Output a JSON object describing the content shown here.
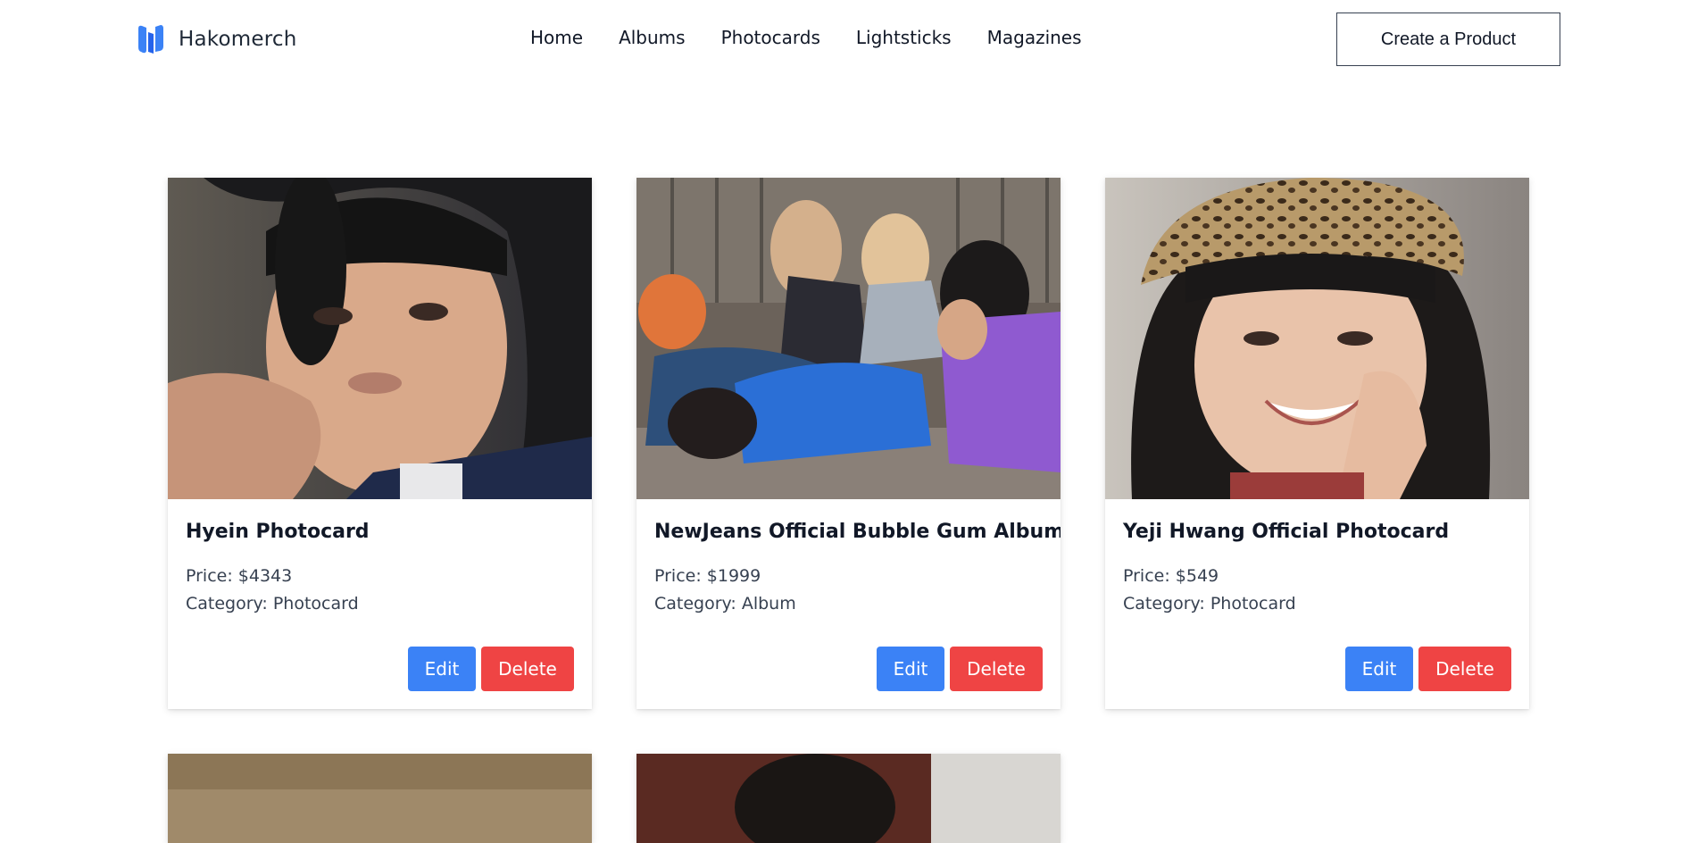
{
  "brand": {
    "name": "Hakomerch",
    "logo_icon": "hakomerch-logo-icon",
    "accent": "#3b82f6"
  },
  "nav": {
    "links": [
      "Home",
      "Albums",
      "Photocards",
      "Lightsticks",
      "Magazines"
    ],
    "cta_label": "Create a Product"
  },
  "colors": {
    "edit": "#3b82f6",
    "delete": "#ef4444"
  },
  "products": [
    {
      "title": "Hyein Photocard",
      "price": "Price: $4343",
      "category": "Category: Photocard",
      "edit_label": "Edit",
      "delete_label": "Delete"
    },
    {
      "title": "NewJeans Official Bubble Gum Album",
      "price": "Price: $1999",
      "category": "Category: Album",
      "edit_label": "Edit",
      "delete_label": "Delete"
    },
    {
      "title": "Yeji Hwang Official Photocard",
      "price": "Price: $549",
      "category": "Category: Photocard",
      "edit_label": "Edit",
      "delete_label": "Delete"
    }
  ]
}
